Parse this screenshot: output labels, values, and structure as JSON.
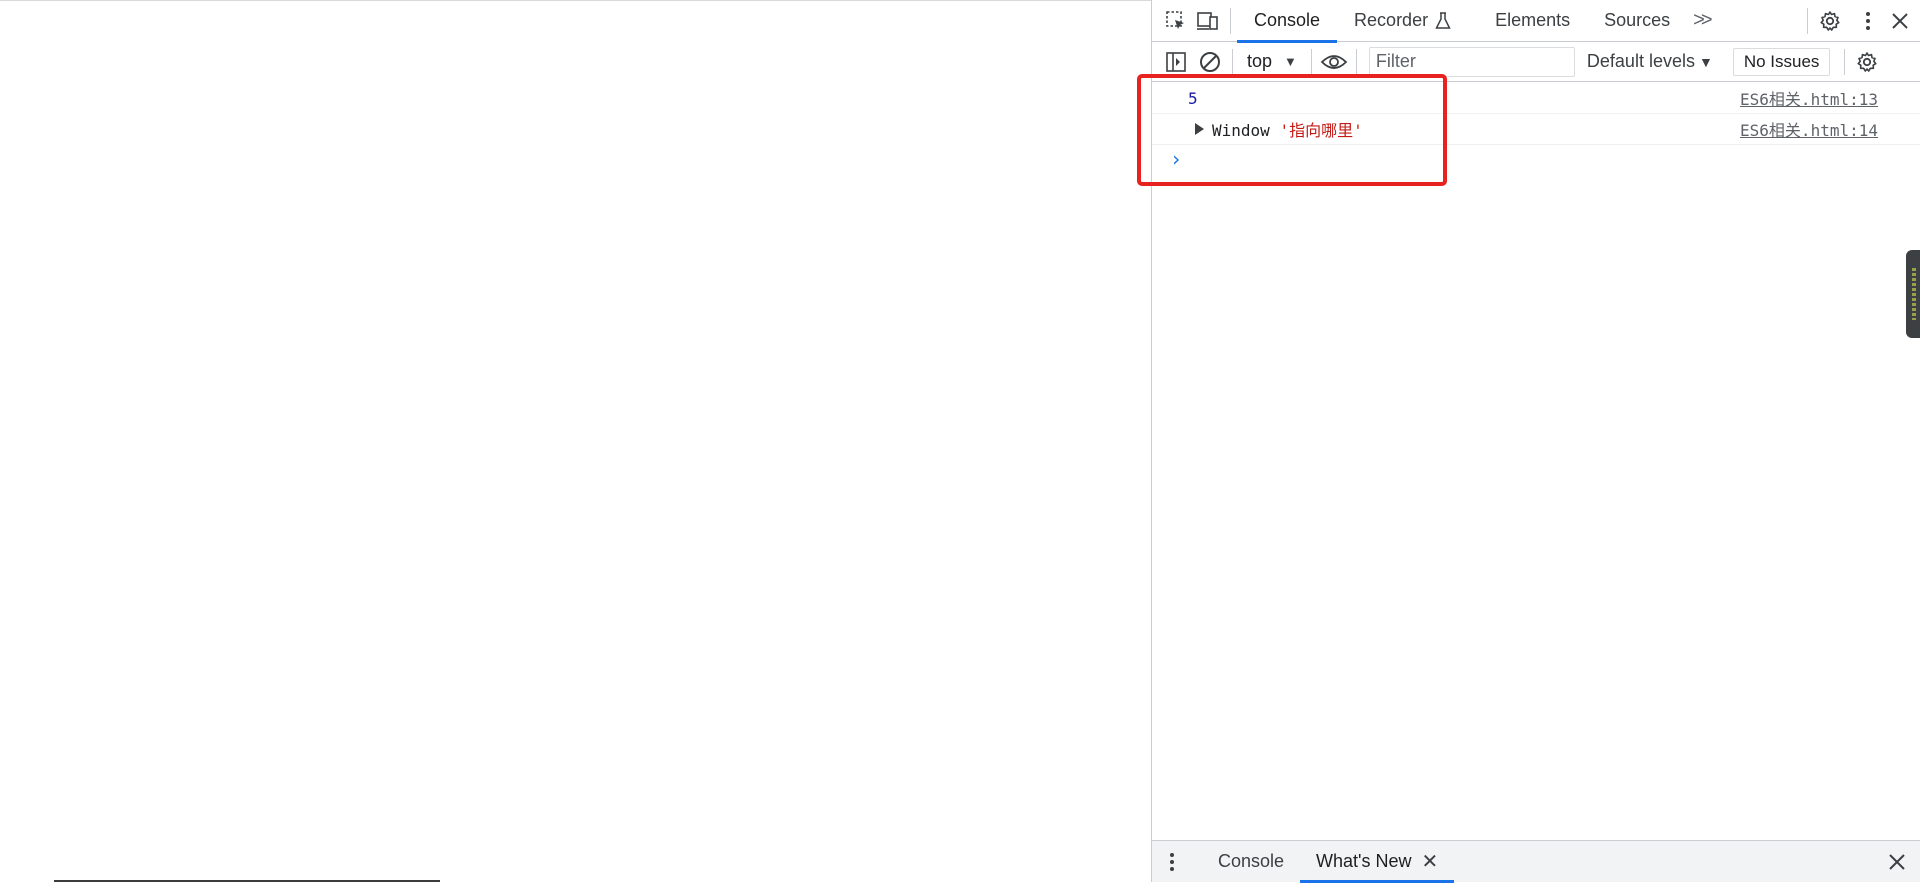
{
  "devtools": {
    "main_tabs": [
      {
        "label": "Console",
        "active": true
      },
      {
        "label": "Recorder",
        "active": false
      },
      {
        "label": "Elements",
        "active": false
      },
      {
        "label": "Sources",
        "active": false
      }
    ],
    "more_tabs_glyph": ">>",
    "console_toolbar": {
      "context": "top",
      "filter_placeholder": "Filter",
      "levels": "Default levels",
      "issues": "No Issues"
    },
    "messages": [
      {
        "value": "5",
        "source": "ES6相关.html:13"
      },
      {
        "object_name": "Window",
        "object_string": "'指向哪里'",
        "source": "ES6相关.html:14"
      }
    ],
    "prompt": "›",
    "drawer_tabs": [
      {
        "label": "Console",
        "active": false
      },
      {
        "label": "What's New",
        "active": true
      }
    ]
  },
  "colors": {
    "accent": "#1a73e8",
    "highlight": "#e8221e",
    "string": "#c41a16",
    "number": "#1a1aa6"
  }
}
